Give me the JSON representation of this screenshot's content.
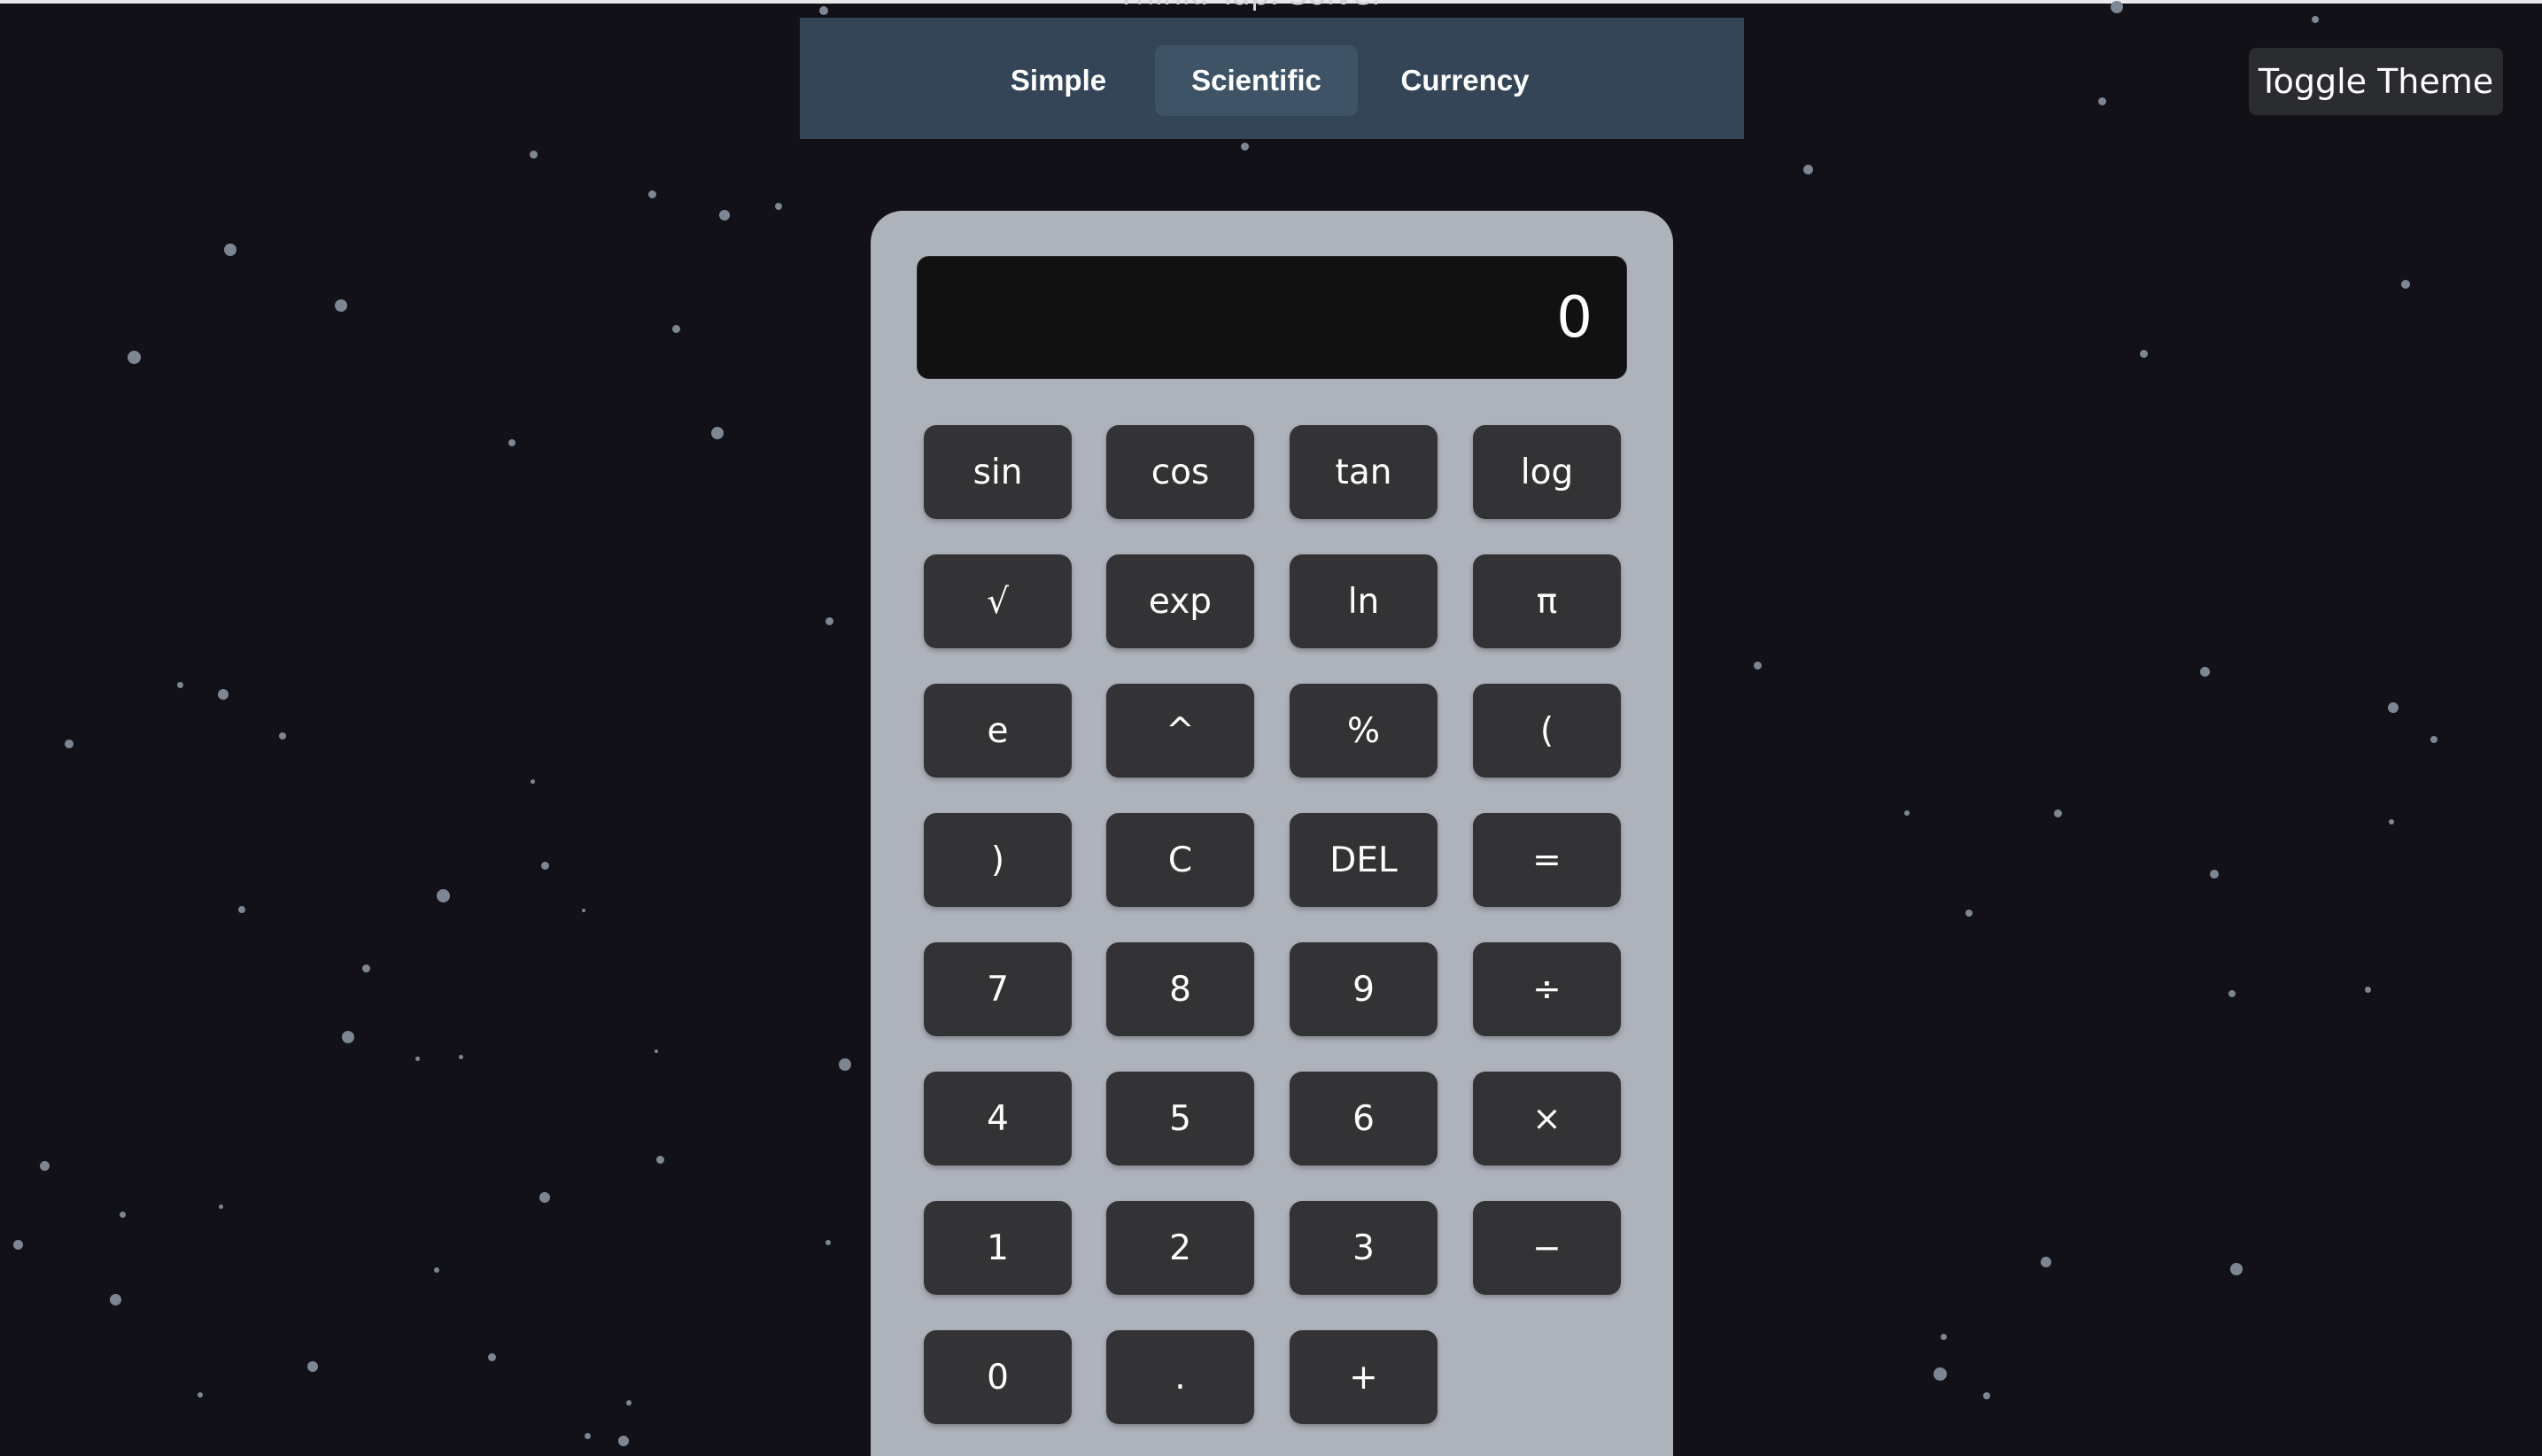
{
  "header": {
    "tagline": "Think. Tap. Solve."
  },
  "nav": {
    "tabs": [
      {
        "label": "Simple"
      },
      {
        "label": "Scientific"
      },
      {
        "label": "Currency"
      }
    ],
    "active_tab": "Scientific"
  },
  "theme_toggle": {
    "label": "Toggle Theme"
  },
  "display": {
    "value": "0"
  },
  "keypad": {
    "rows": [
      [
        "sin",
        "cos",
        "tan",
        "log"
      ],
      [
        "√",
        "exp",
        "ln",
        "π"
      ],
      [
        "e",
        "^",
        "%",
        "("
      ],
      [
        ")",
        "C",
        "DEL",
        "="
      ],
      [
        "7",
        "8",
        "9",
        "÷"
      ],
      [
        "4",
        "5",
        "6",
        "×"
      ],
      [
        "1",
        "2",
        "3",
        "−"
      ],
      [
        "0",
        ".",
        "+"
      ]
    ]
  },
  "colors": {
    "background": "#111117",
    "nav_bar": "#344558",
    "calculator_body": "#aeb2bb",
    "key": "#333335",
    "display": "#111111",
    "star": "#7d8793"
  }
}
